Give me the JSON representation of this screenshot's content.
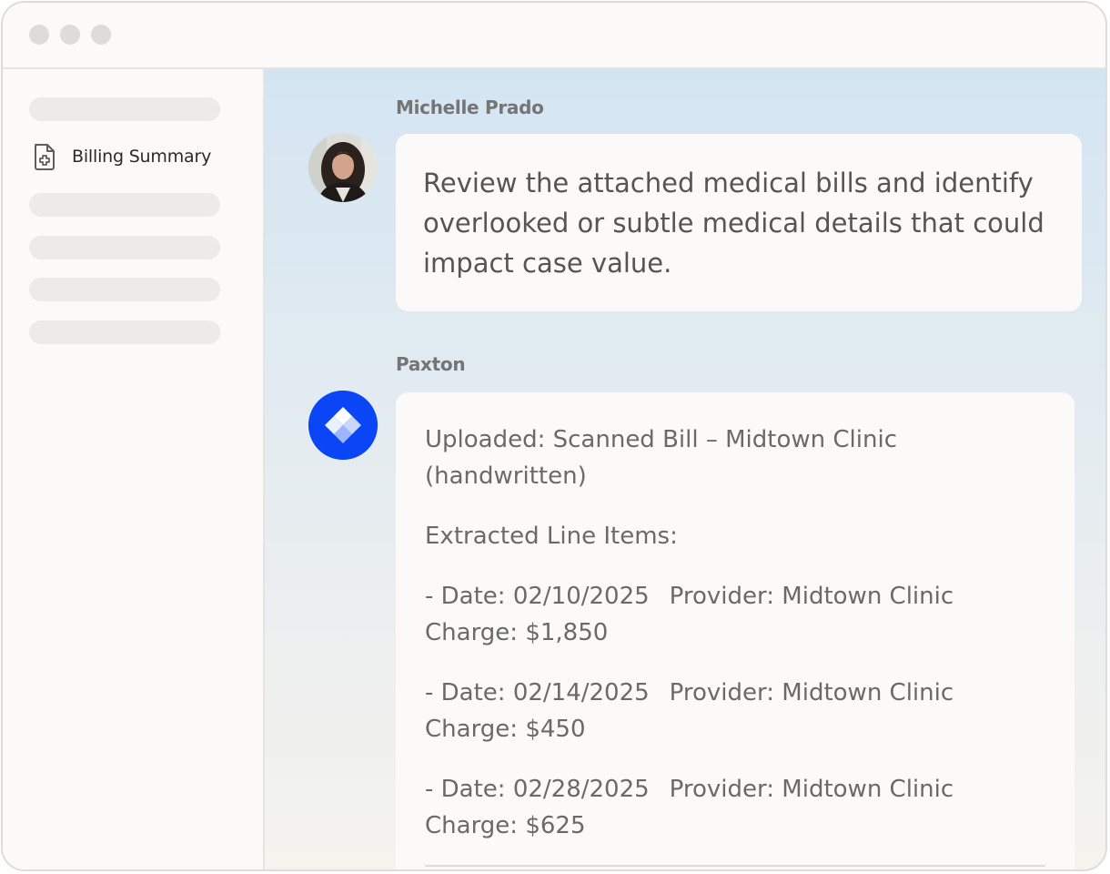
{
  "window": {
    "controls": [
      "close-dot",
      "minimize-dot",
      "maximize-dot"
    ]
  },
  "sidebar": {
    "active_item": {
      "label": "Billing Summary",
      "icon": "document-plus-icon"
    }
  },
  "conversation": {
    "user_message": {
      "sender": "Michelle Prado",
      "text": "Review the attached medical bills and identify overlooked or subtle medical details that could impact case value."
    },
    "bot_message": {
      "sender": "Paxton",
      "uploaded": "Uploaded: Scanned Bill – Midtown Clinic (handwritten)",
      "extracted_heading": "Extracted Line Items:",
      "line_items": [
        {
          "date": "- Date: 02/10/2025",
          "provider": "Provider: Midtown Clinic",
          "charge": "Charge: $1,850"
        },
        {
          "date": "- Date: 02/14/2025",
          "provider": "Provider: Midtown Clinic",
          "charge": "Charge: $450"
        },
        {
          "date": "- Date: 02/28/2025",
          "provider": "Provider: Midtown Clinic",
          "charge": "Charge: $625"
        }
      ]
    }
  },
  "colors": {
    "brand_blue": "#0a46f5",
    "sender_gray": "#757575"
  }
}
